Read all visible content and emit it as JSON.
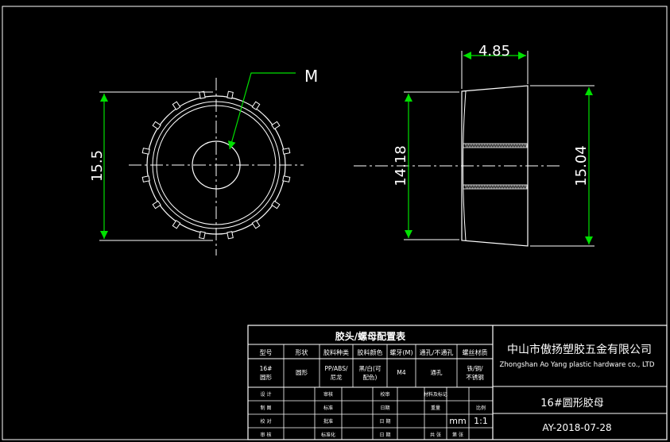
{
  "drawing": {
    "front_view": {
      "height_dim": "15.5",
      "bore_label": "M"
    },
    "side_view": {
      "width_dim": "4.85",
      "inner_height_dim": "14.18",
      "outer_height_dim": "15.04"
    }
  },
  "title_block": {
    "table_title": "胶头/螺母配置表",
    "headers": [
      "型号",
      "形状",
      "胶料种类",
      "胶料颜色",
      "螺牙(M)",
      "通孔/不通孔",
      "螺丝材质"
    ],
    "row": [
      "16#\n圆形",
      "圆形",
      "PP/ABS/\n尼龙",
      "黑/白(可\n配色)",
      "M4",
      "通孔",
      "铁/铜/\n不锈钢"
    ],
    "sign_rows": [
      [
        "设 计",
        "",
        "审核",
        "",
        "校审",
        "",
        "材料及标记",
        "",
        ""
      ],
      [
        "制 图",
        "",
        "标准",
        "",
        "日期",
        "",
        "重量",
        "",
        "比例"
      ],
      [
        "校 对",
        "",
        "批准",
        "",
        "日 期",
        "",
        "",
        "mm",
        "1:1"
      ],
      [
        "审 核",
        "",
        "标准化",
        "",
        "日 期",
        "",
        "共  张",
        "第 张",
        ""
      ]
    ],
    "company_cn": "中山市傲扬塑胶五金有限公司",
    "company_en": "Zhongshan Ao Yang plastic hardware co., LTD",
    "part_name": "16#圆形胶母",
    "drawing_code": "AY-2018-07-28"
  }
}
